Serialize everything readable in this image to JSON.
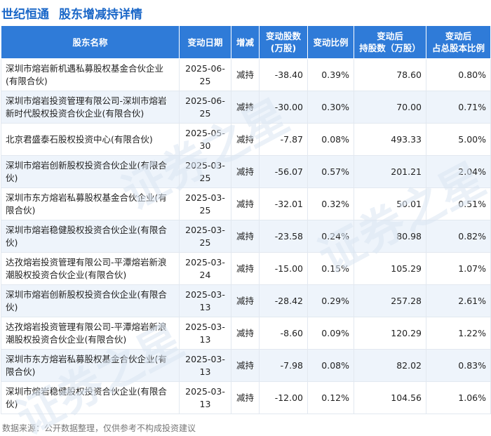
{
  "header": {
    "company": "世纪恒通",
    "title": "股东增减持详情"
  },
  "columns": [
    "股东名称",
    "变动日期",
    "增减",
    "变动股数\n(万股)",
    "变动比例",
    "变动后\n持股数（万股）",
    "变动后\n占总股本比例"
  ],
  "rows": [
    {
      "name": "深圳市熔岩新机遇私募股权基金合伙企业(有限合伙)",
      "date": "2025-06-25",
      "direction": "减持",
      "change": "-38.40",
      "ratio": "0.39%",
      "after": "78.60",
      "pct": "0.80%"
    },
    {
      "name": "深圳市熔岩投资管理有限公司-深圳市熔岩新时代股权投资合伙企业(有限合伙)",
      "date": "2025-06-25",
      "direction": "减持",
      "change": "-30.00",
      "ratio": "0.30%",
      "after": "70.00",
      "pct": "0.71%"
    },
    {
      "name": "北京君盛泰石股权投资中心(有限合伙)",
      "date": "2025-05-30",
      "direction": "减持",
      "change": "-7.87",
      "ratio": "0.08%",
      "after": "493.33",
      "pct": "5.00%"
    },
    {
      "name": "深圳市熔岩创新股权投资合伙企业(有限合伙)",
      "date": "2025-03-25",
      "direction": "减持",
      "change": "-56.07",
      "ratio": "0.57%",
      "after": "201.21",
      "pct": "2.04%"
    },
    {
      "name": "深圳市东方熔岩私募股权基金合伙企业(有限合伙)",
      "date": "2025-03-25",
      "direction": "减持",
      "change": "-32.01",
      "ratio": "0.32%",
      "after": "50.01",
      "pct": "0.51%"
    },
    {
      "name": "深圳市熔岩稳健股权投资合伙企业(有限合伙)",
      "date": "2025-03-25",
      "direction": "减持",
      "change": "-23.58",
      "ratio": "0.24%",
      "after": "80.98",
      "pct": "0.82%"
    },
    {
      "name": "达孜熔岩投资管理有限公司-平潭熔岩新浪潮股权投资合伙企业(有限合伙)",
      "date": "2025-03-24",
      "direction": "减持",
      "change": "-15.00",
      "ratio": "0.15%",
      "after": "105.29",
      "pct": "1.07%"
    },
    {
      "name": "深圳市熔岩创新股权投资合伙企业(有限合伙)",
      "date": "2025-03-13",
      "direction": "减持",
      "change": "-28.42",
      "ratio": "0.29%",
      "after": "257.28",
      "pct": "2.61%"
    },
    {
      "name": "达孜熔岩投资管理有限公司-平潭熔岩新浪潮股权投资合伙企业(有限合伙)",
      "date": "2025-03-13",
      "direction": "减持",
      "change": "-8.60",
      "ratio": "0.09%",
      "after": "120.29",
      "pct": "1.22%"
    },
    {
      "name": "深圳市东方熔岩私募股权基金合伙企业(有限合伙)",
      "date": "2025-03-13",
      "direction": "减持",
      "change": "-7.98",
      "ratio": "0.08%",
      "after": "82.02",
      "pct": "0.83%"
    },
    {
      "name": "深圳市熔岩稳健股权投资合伙企业(有限合伙)",
      "date": "2025-03-13",
      "direction": "减持",
      "change": "-12.00",
      "ratio": "0.12%",
      "after": "104.56",
      "pct": "1.06%"
    }
  ],
  "footer": "数据来源：公开数据整理，仅供参考不构成投资建议",
  "watermark": "证券之星",
  "colors": {
    "brand_blue": "#1a67c8",
    "header_bg": "#2f7bd8",
    "decrease_green": "#1ea33b",
    "stripe": "#eef4fb"
  }
}
